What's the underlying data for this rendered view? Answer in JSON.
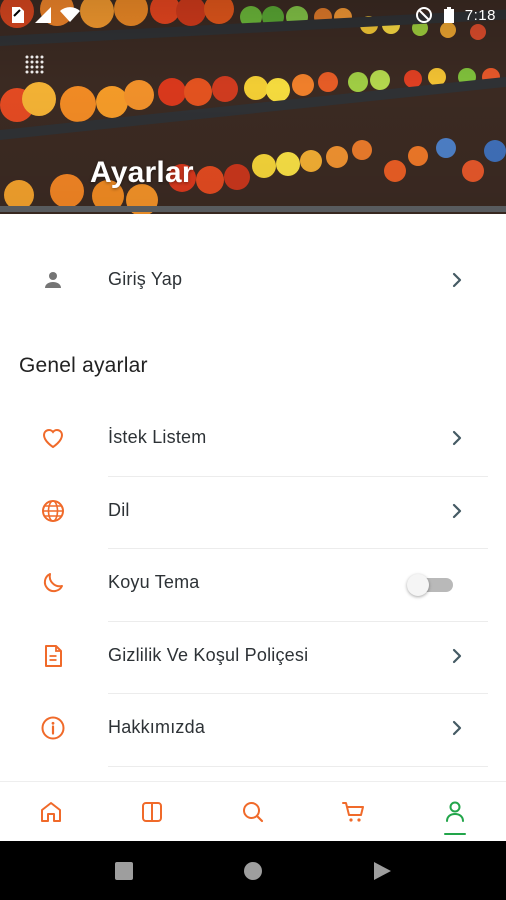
{
  "status_bar": {
    "time": "7:18"
  },
  "header": {
    "title": "Ayarlar"
  },
  "login": {
    "label": "Giriş Yap"
  },
  "general": {
    "section_title": "Genel ayarlar",
    "items": [
      {
        "label": "İstek Listem",
        "icon": "heart-icon"
      },
      {
        "label": "Dil",
        "icon": "globe-icon"
      },
      {
        "label": "Koyu Tema",
        "icon": "moon-icon",
        "toggle_on": false
      },
      {
        "label": "Gizlilik Ve Koşul Poliçesi",
        "icon": "document-icon"
      },
      {
        "label": "Hakkımızda",
        "icon": "info-icon"
      }
    ]
  },
  "bottom_nav": {
    "items": [
      {
        "icon": "home-icon",
        "active": false
      },
      {
        "icon": "catalog-icon",
        "active": false
      },
      {
        "icon": "search-icon",
        "active": false
      },
      {
        "icon": "cart-icon",
        "active": false
      },
      {
        "icon": "profile-icon",
        "active": true
      }
    ]
  },
  "colors": {
    "accent": "#f06a2a",
    "active": "#22a54a",
    "text": "#2d3236",
    "chevron": "#455a64",
    "person_icon": "#757575"
  }
}
